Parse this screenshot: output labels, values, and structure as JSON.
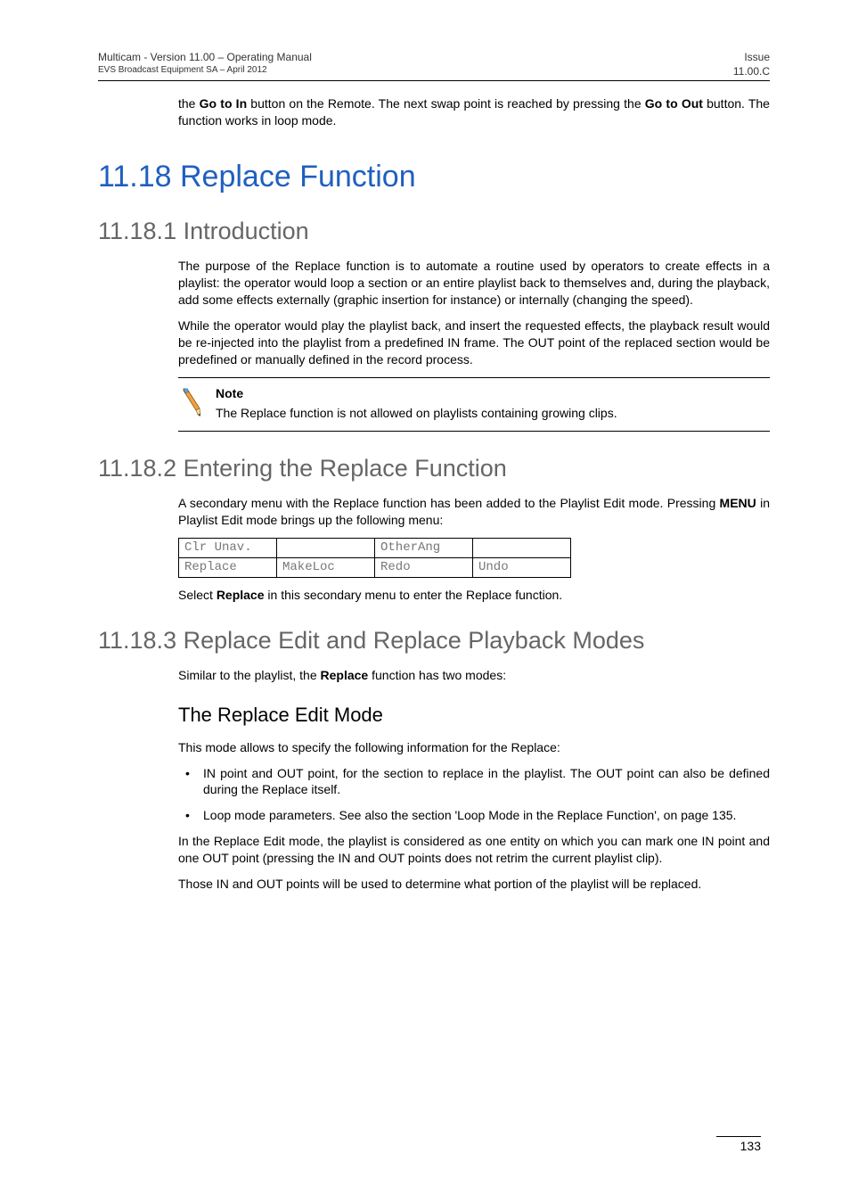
{
  "header": {
    "title_line": "Multicam - Version 11.00 – Operating Manual",
    "sub_line": "EVS Broadcast Equipment SA – April 2012",
    "issue_label": "Issue",
    "issue_value": "11.00.C"
  },
  "intro_para_pre": "the ",
  "intro_b1": "Go to In",
  "intro_mid": " button on the Remote. The next swap point is reached by pressing the ",
  "intro_b2": "Go to Out",
  "intro_post": " button. The function works in loop mode.",
  "h1": "11.18 Replace Function",
  "sec1": {
    "h2": "11.18.1  Introduction",
    "p1": "The purpose of the Replace function is to automate a routine used by operators to create effects in a playlist: the operator would loop a section or an entire playlist back to themselves and, during the playback, add some effects externally (graphic insertion for instance) or internally (changing the speed).",
    "p2": "While the operator would play the playlist back, and insert the requested effects, the playback result would be re-injected into the playlist from a predefined IN frame. The OUT point of the replaced section would be predefined or manually defined in the record process.",
    "note_label": "Note",
    "note_text": "The Replace function is not allowed on playlists containing growing clips."
  },
  "sec2": {
    "h2": "11.18.2  Entering the Replace Function",
    "p1_pre": "A secondary menu with the Replace function has been added to the Playlist Edit mode. Pressing ",
    "p1_b": "MENU",
    "p1_post": " in Playlist Edit mode brings up the following menu:",
    "menu": {
      "r1": [
        "Clr Unav.",
        "",
        "OtherAng",
        ""
      ],
      "r2": [
        "Replace",
        "MakeLoc",
        "Redo",
        "Undo"
      ]
    },
    "p2_pre": "Select ",
    "p2_b": "Replace",
    "p2_post": " in this secondary menu to enter the Replace function."
  },
  "sec3": {
    "h2": "11.18.3  Replace Edit and Replace Playback Modes",
    "p1_pre": "Similar to the playlist, the ",
    "p1_b": "Replace",
    "p1_post": " function has two modes:",
    "h3": "The Replace Edit Mode",
    "p2": "This mode allows to specify the following information for the Replace:",
    "li1": "IN point and OUT point, for the section to replace in the playlist. The OUT point can also be defined during the Replace itself.",
    "li2": "Loop mode parameters. See also the section 'Loop Mode in the Replace Function', on page 135.",
    "p3": "In the Replace Edit mode, the playlist is considered as one entity on which you can mark one IN point and one OUT point (pressing the IN and OUT points does not retrim the current playlist clip).",
    "p4": "Those IN and OUT points will be used to determine what portion of the playlist will be replaced."
  },
  "page_number": "133"
}
